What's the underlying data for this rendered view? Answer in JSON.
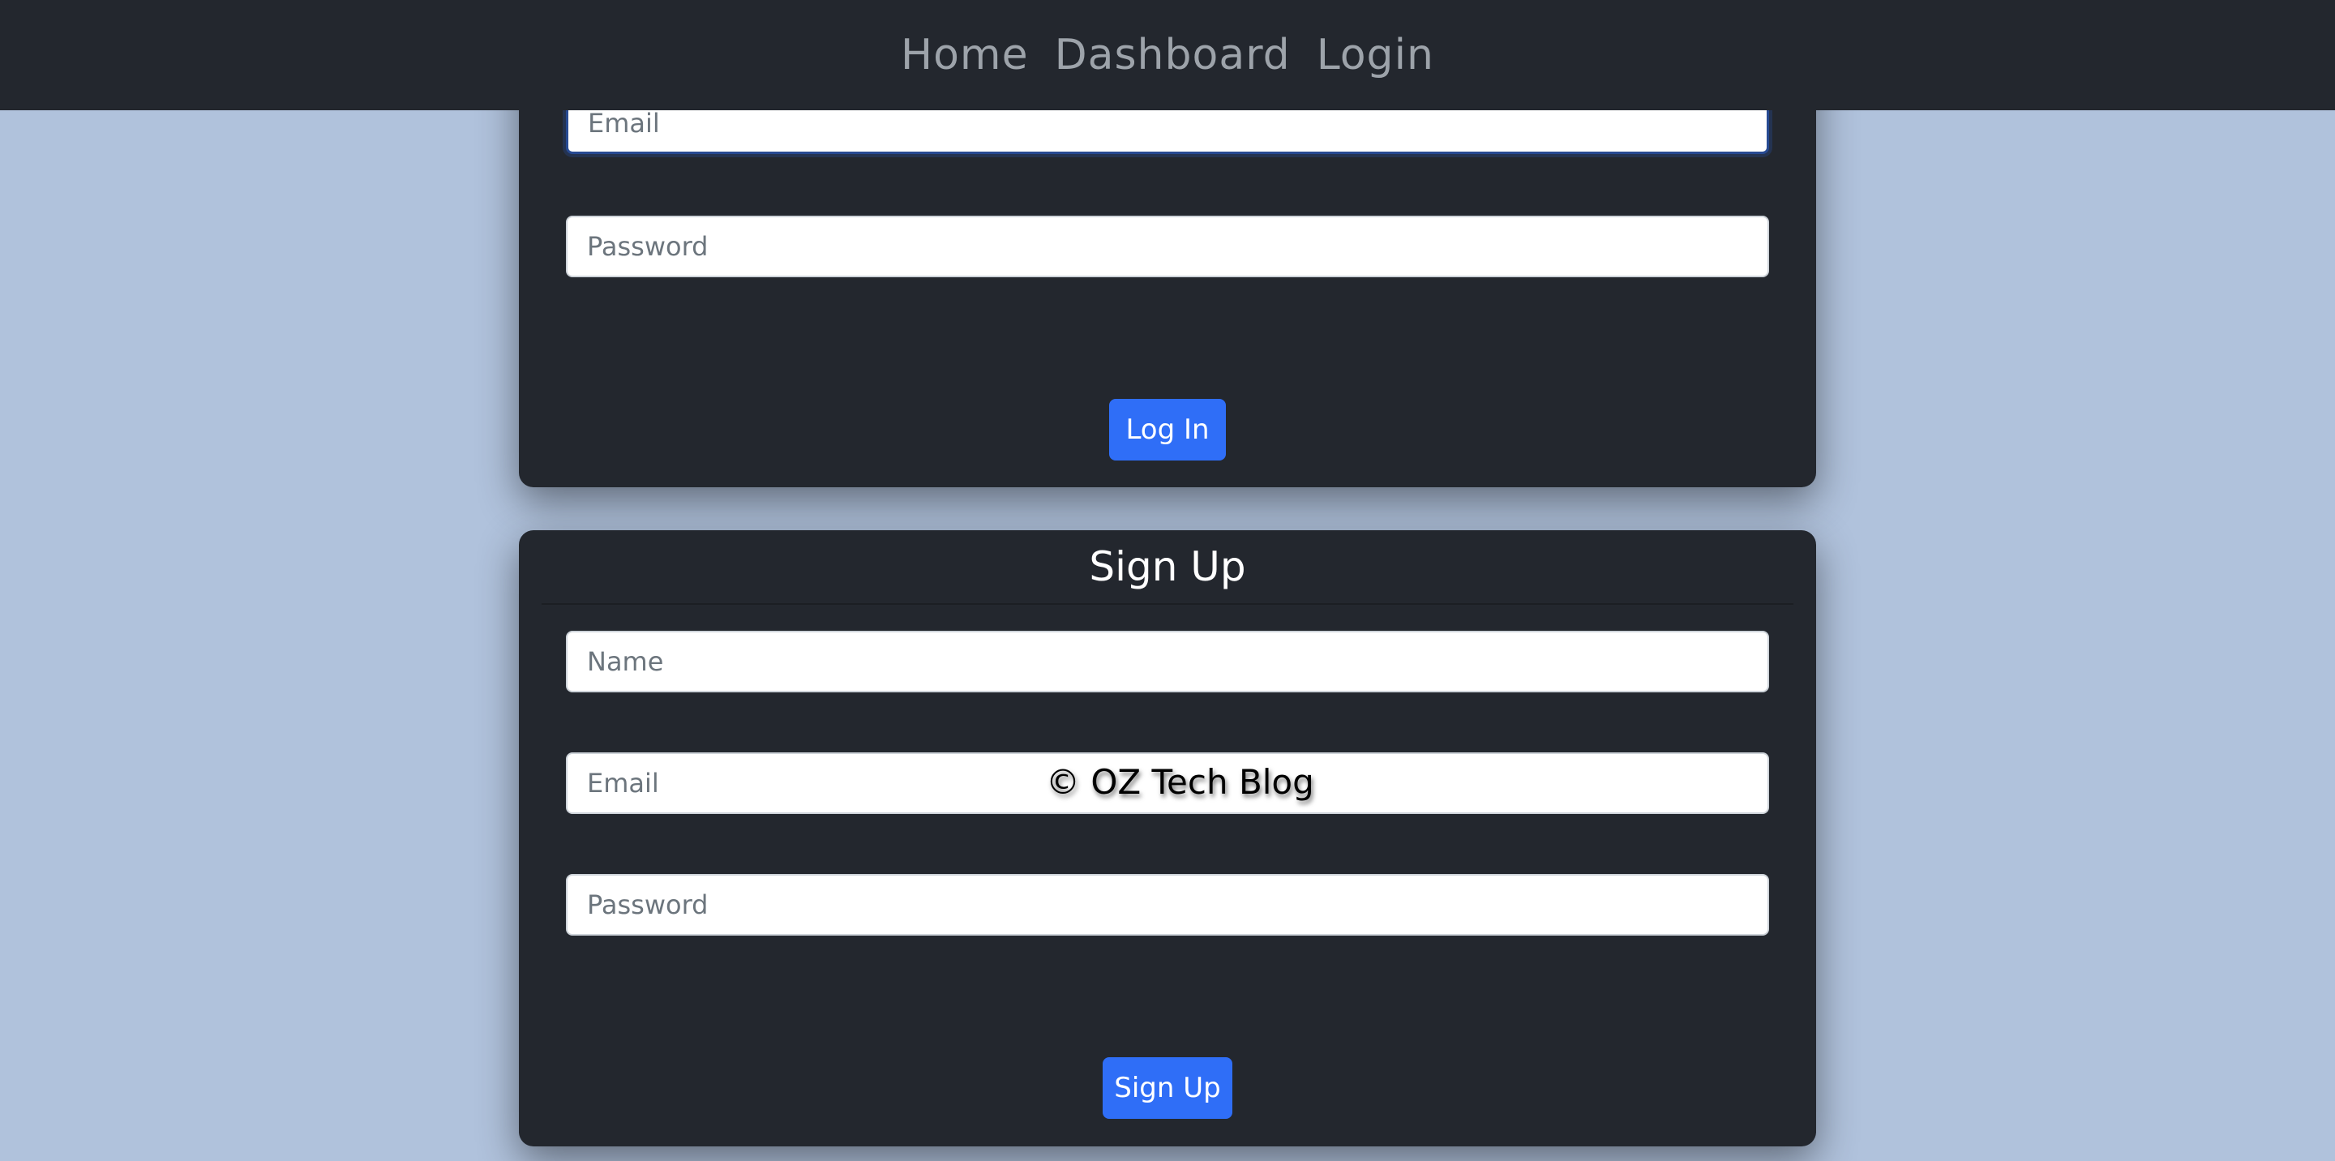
{
  "nav": {
    "items": [
      {
        "label": "Home"
      },
      {
        "label": "Dashboard"
      },
      {
        "label": "Login"
      }
    ]
  },
  "login": {
    "email_placeholder": "Email",
    "password_placeholder": "Password",
    "submit_label": "Log In"
  },
  "signup": {
    "title": "Sign Up",
    "name_placeholder": "Name",
    "email_placeholder": "Email",
    "password_placeholder": "Password",
    "submit_label": "Sign Up"
  },
  "watermark": "© OZ Tech Blog",
  "colors": {
    "background": "#b0c2dc",
    "navbar": "#23272e",
    "card": "#23272e",
    "primary_button": "#2f6ef7",
    "focus_border": "#274a92"
  }
}
